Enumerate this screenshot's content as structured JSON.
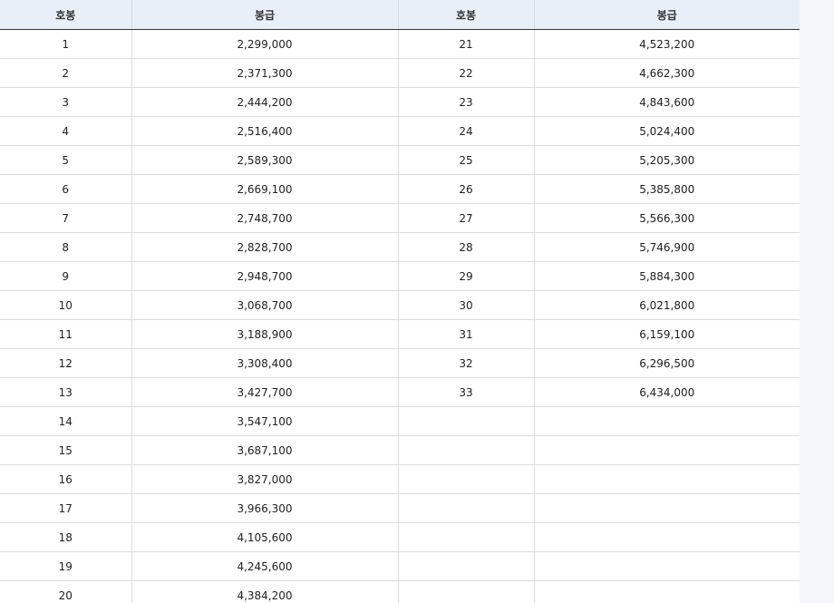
{
  "table": {
    "headers": [
      "호봉",
      "봉급",
      "호봉",
      "봉급"
    ],
    "rows": [
      [
        "1",
        "2,299,000",
        "21",
        "4,523,200"
      ],
      [
        "2",
        "2,371,300",
        "22",
        "4,662,300"
      ],
      [
        "3",
        "2,444,200",
        "23",
        "4,843,600"
      ],
      [
        "4",
        "2,516,400",
        "24",
        "5,024,400"
      ],
      [
        "5",
        "2,589,300",
        "25",
        "5,205,300"
      ],
      [
        "6",
        "2,669,100",
        "26",
        "5,385,800"
      ],
      [
        "7",
        "2,748,700",
        "27",
        "5,566,300"
      ],
      [
        "8",
        "2,828,700",
        "28",
        "5,746,900"
      ],
      [
        "9",
        "2,948,700",
        "29",
        "5,884,300"
      ],
      [
        "10",
        "3,068,700",
        "30",
        "6,021,800"
      ],
      [
        "11",
        "3,188,900",
        "31",
        "6,159,100"
      ],
      [
        "12",
        "3,308,400",
        "32",
        "6,296,500"
      ],
      [
        "13",
        "3,427,700",
        "33",
        "6,434,000"
      ],
      [
        "14",
        "3,547,100",
        "",
        ""
      ],
      [
        "15",
        "3,687,100",
        "",
        ""
      ],
      [
        "16",
        "3,827,000",
        "",
        ""
      ],
      [
        "17",
        "3,966,300",
        "",
        ""
      ],
      [
        "18",
        "4,105,600",
        "",
        ""
      ],
      [
        "19",
        "4,245,600",
        "",
        ""
      ],
      [
        "20",
        "4,384,200",
        "",
        ""
      ]
    ]
  },
  "colors": {
    "header_background": "#e9eff9",
    "header_rule": "#2b3a55",
    "grid_line": "#dddddd",
    "page_background": "#f5f6fa"
  }
}
